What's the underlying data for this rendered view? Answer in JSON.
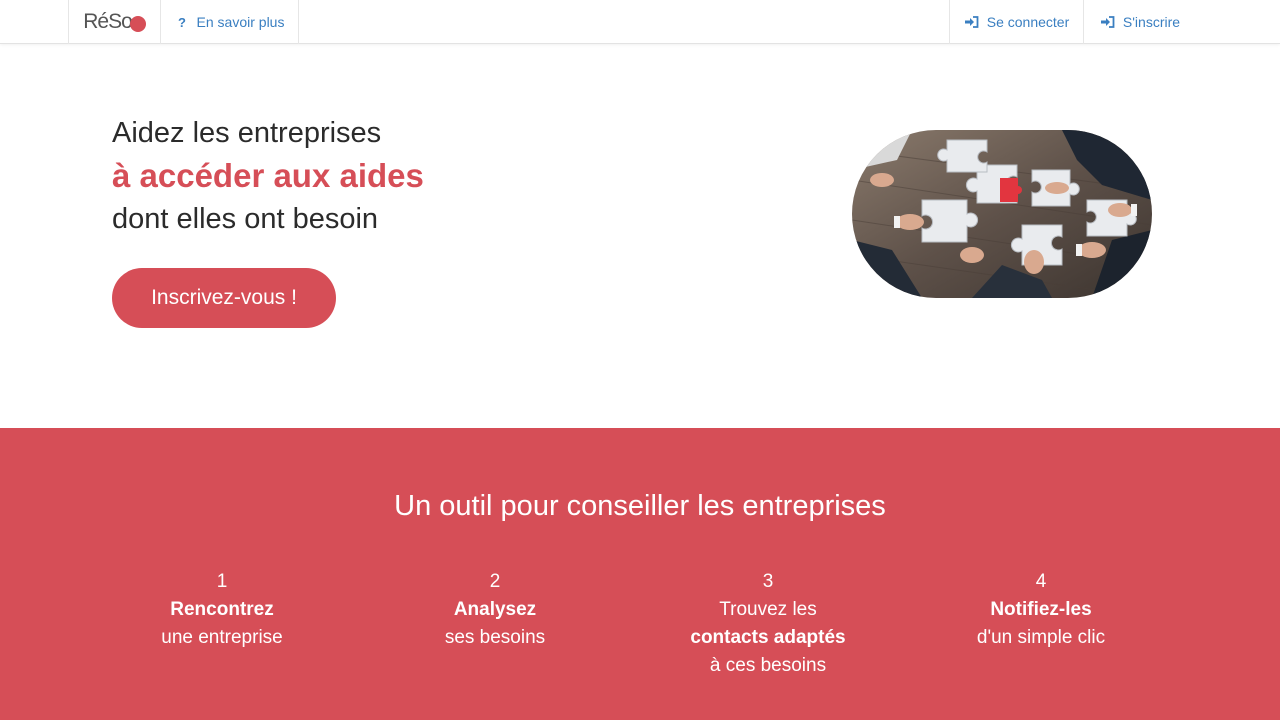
{
  "nav": {
    "logo_text": "RéSo",
    "logo_badge": "",
    "learn_more": "En savoir plus",
    "login": "Se connecter",
    "signup": "S'inscrire"
  },
  "hero": {
    "line1": "Aidez les entreprises",
    "line2": "à accéder aux aides",
    "line3": "dont elles ont besoin",
    "cta": "Inscrivez-vous !",
    "image_icon": "puzzle-teamwork-image"
  },
  "features": {
    "title": "Un outil pour conseiller les entreprises",
    "steps": [
      {
        "number": "1",
        "line1": "Rencontrez",
        "line2": "une entreprise",
        "line3": ""
      },
      {
        "number": "2",
        "line1": "Analysez",
        "line2": "ses besoins",
        "line3": ""
      },
      {
        "number": "3",
        "line1": "Trouvez les",
        "line2": "contacts adaptés",
        "line3": "à ces besoins"
      },
      {
        "number": "4",
        "line1": "Notifiez-les",
        "line2": "d'un simple clic",
        "line3": ""
      }
    ]
  },
  "colors": {
    "accent": "#d64e57",
    "link": "#3a7fc1",
    "text": "#2b2b2b"
  }
}
